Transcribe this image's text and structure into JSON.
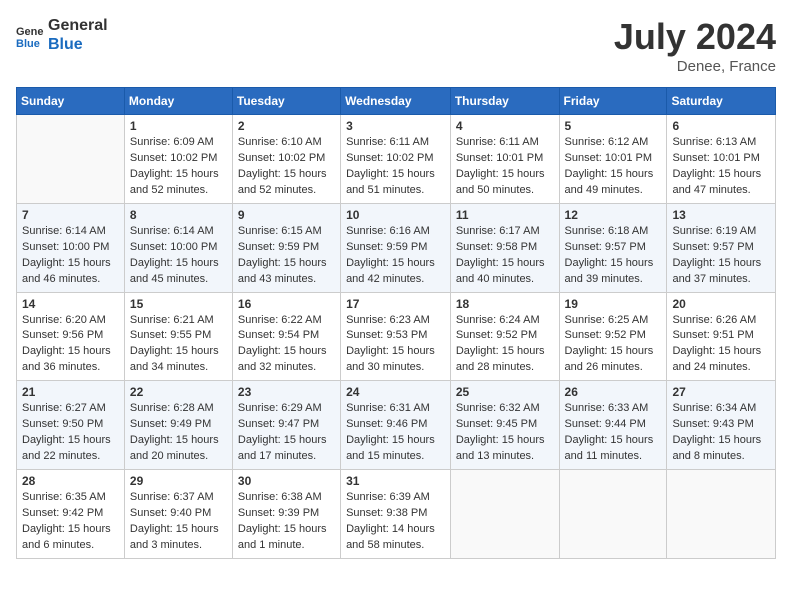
{
  "header": {
    "logo_general": "General",
    "logo_blue": "Blue",
    "month_year": "July 2024",
    "location": "Denee, France"
  },
  "days_of_week": [
    "Sunday",
    "Monday",
    "Tuesday",
    "Wednesday",
    "Thursday",
    "Friday",
    "Saturday"
  ],
  "weeks": [
    [
      {
        "day": "",
        "info": ""
      },
      {
        "day": "1",
        "info": "Sunrise: 6:09 AM\nSunset: 10:02 PM\nDaylight: 15 hours\nand 52 minutes."
      },
      {
        "day": "2",
        "info": "Sunrise: 6:10 AM\nSunset: 10:02 PM\nDaylight: 15 hours\nand 52 minutes."
      },
      {
        "day": "3",
        "info": "Sunrise: 6:11 AM\nSunset: 10:02 PM\nDaylight: 15 hours\nand 51 minutes."
      },
      {
        "day": "4",
        "info": "Sunrise: 6:11 AM\nSunset: 10:01 PM\nDaylight: 15 hours\nand 50 minutes."
      },
      {
        "day": "5",
        "info": "Sunrise: 6:12 AM\nSunset: 10:01 PM\nDaylight: 15 hours\nand 49 minutes."
      },
      {
        "day": "6",
        "info": "Sunrise: 6:13 AM\nSunset: 10:01 PM\nDaylight: 15 hours\nand 47 minutes."
      }
    ],
    [
      {
        "day": "7",
        "info": "Sunrise: 6:14 AM\nSunset: 10:00 PM\nDaylight: 15 hours\nand 46 minutes."
      },
      {
        "day": "8",
        "info": "Sunrise: 6:14 AM\nSunset: 10:00 PM\nDaylight: 15 hours\nand 45 minutes."
      },
      {
        "day": "9",
        "info": "Sunrise: 6:15 AM\nSunset: 9:59 PM\nDaylight: 15 hours\nand 43 minutes."
      },
      {
        "day": "10",
        "info": "Sunrise: 6:16 AM\nSunset: 9:59 PM\nDaylight: 15 hours\nand 42 minutes."
      },
      {
        "day": "11",
        "info": "Sunrise: 6:17 AM\nSunset: 9:58 PM\nDaylight: 15 hours\nand 40 minutes."
      },
      {
        "day": "12",
        "info": "Sunrise: 6:18 AM\nSunset: 9:57 PM\nDaylight: 15 hours\nand 39 minutes."
      },
      {
        "day": "13",
        "info": "Sunrise: 6:19 AM\nSunset: 9:57 PM\nDaylight: 15 hours\nand 37 minutes."
      }
    ],
    [
      {
        "day": "14",
        "info": "Sunrise: 6:20 AM\nSunset: 9:56 PM\nDaylight: 15 hours\nand 36 minutes."
      },
      {
        "day": "15",
        "info": "Sunrise: 6:21 AM\nSunset: 9:55 PM\nDaylight: 15 hours\nand 34 minutes."
      },
      {
        "day": "16",
        "info": "Sunrise: 6:22 AM\nSunset: 9:54 PM\nDaylight: 15 hours\nand 32 minutes."
      },
      {
        "day": "17",
        "info": "Sunrise: 6:23 AM\nSunset: 9:53 PM\nDaylight: 15 hours\nand 30 minutes."
      },
      {
        "day": "18",
        "info": "Sunrise: 6:24 AM\nSunset: 9:52 PM\nDaylight: 15 hours\nand 28 minutes."
      },
      {
        "day": "19",
        "info": "Sunrise: 6:25 AM\nSunset: 9:52 PM\nDaylight: 15 hours\nand 26 minutes."
      },
      {
        "day": "20",
        "info": "Sunrise: 6:26 AM\nSunset: 9:51 PM\nDaylight: 15 hours\nand 24 minutes."
      }
    ],
    [
      {
        "day": "21",
        "info": "Sunrise: 6:27 AM\nSunset: 9:50 PM\nDaylight: 15 hours\nand 22 minutes."
      },
      {
        "day": "22",
        "info": "Sunrise: 6:28 AM\nSunset: 9:49 PM\nDaylight: 15 hours\nand 20 minutes."
      },
      {
        "day": "23",
        "info": "Sunrise: 6:29 AM\nSunset: 9:47 PM\nDaylight: 15 hours\nand 17 minutes."
      },
      {
        "day": "24",
        "info": "Sunrise: 6:31 AM\nSunset: 9:46 PM\nDaylight: 15 hours\nand 15 minutes."
      },
      {
        "day": "25",
        "info": "Sunrise: 6:32 AM\nSunset: 9:45 PM\nDaylight: 15 hours\nand 13 minutes."
      },
      {
        "day": "26",
        "info": "Sunrise: 6:33 AM\nSunset: 9:44 PM\nDaylight: 15 hours\nand 11 minutes."
      },
      {
        "day": "27",
        "info": "Sunrise: 6:34 AM\nSunset: 9:43 PM\nDaylight: 15 hours\nand 8 minutes."
      }
    ],
    [
      {
        "day": "28",
        "info": "Sunrise: 6:35 AM\nSunset: 9:42 PM\nDaylight: 15 hours\nand 6 minutes."
      },
      {
        "day": "29",
        "info": "Sunrise: 6:37 AM\nSunset: 9:40 PM\nDaylight: 15 hours\nand 3 minutes."
      },
      {
        "day": "30",
        "info": "Sunrise: 6:38 AM\nSunset: 9:39 PM\nDaylight: 15 hours\nand 1 minute."
      },
      {
        "day": "31",
        "info": "Sunrise: 6:39 AM\nSunset: 9:38 PM\nDaylight: 14 hours\nand 58 minutes."
      },
      {
        "day": "",
        "info": ""
      },
      {
        "day": "",
        "info": ""
      },
      {
        "day": "",
        "info": ""
      }
    ]
  ]
}
